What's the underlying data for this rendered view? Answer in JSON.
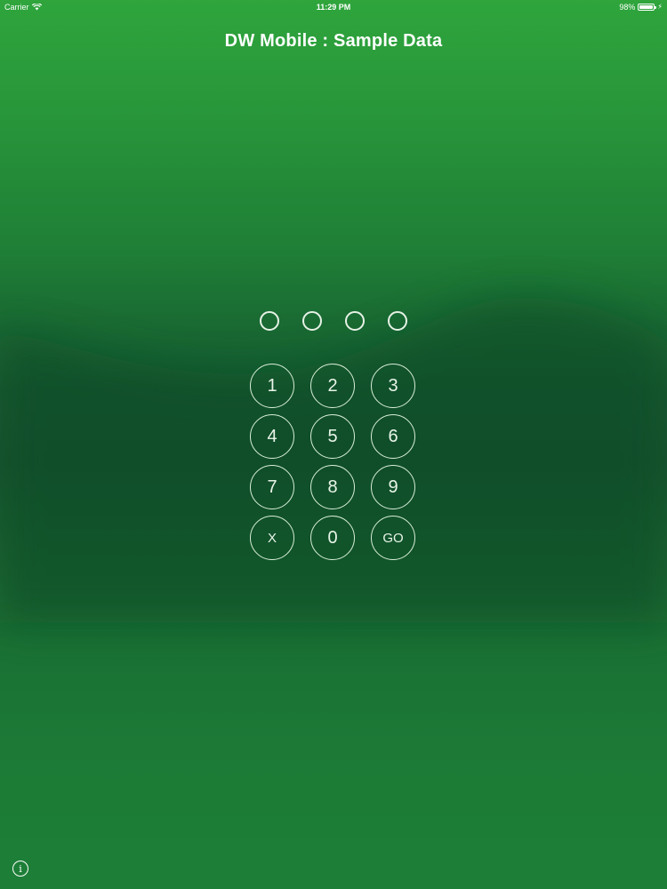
{
  "status_bar": {
    "carrier": "Carrier",
    "time": "11:29 PM",
    "battery_percent": "98%",
    "battery_level": 0.98,
    "wifi_icon": "wifi-icon",
    "charging_icon": "charging-bolt-icon"
  },
  "app": {
    "title": "DW Mobile : Sample Data"
  },
  "pin": {
    "length": 4,
    "entered": 0
  },
  "keypad": {
    "keys": [
      "1",
      "2",
      "3",
      "4",
      "5",
      "6",
      "7",
      "8",
      "9",
      "X",
      "0",
      "GO"
    ]
  },
  "footer": {
    "info_icon": "info-icon",
    "info_glyph": "i"
  },
  "colors": {
    "background_top": "#2fa53c",
    "background_mid": "#14552f",
    "background_bottom": "#1d7f37",
    "foreground": "#ffffff"
  }
}
